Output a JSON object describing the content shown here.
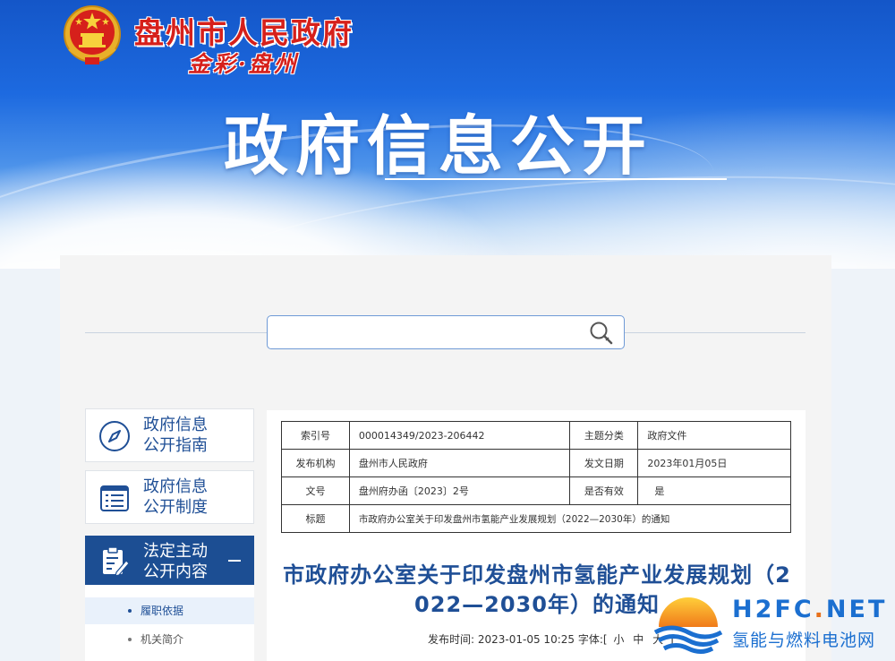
{
  "header": {
    "site_title": "盘州市人民政府",
    "slogan": "金彩·盘州",
    "main_title": "政府信息公开"
  },
  "search": {
    "placeholder": "",
    "value": ""
  },
  "sidebar": {
    "items": [
      {
        "label_line1": "政府信息",
        "label_line2": "公开指南",
        "icon": "compass-icon",
        "active": false
      },
      {
        "label_line1": "政府信息",
        "label_line2": "公开制度",
        "icon": "list-icon",
        "active": false
      },
      {
        "label_line1": "法定主动",
        "label_line2": "公开内容",
        "icon": "clipboard-edit-icon",
        "active": true
      }
    ],
    "sub_items": [
      {
        "label": "履职依据",
        "active": true
      },
      {
        "label": "机关简介",
        "active": false
      }
    ]
  },
  "meta": {
    "index_label": "索引号",
    "index_value": "000014349/2023-206442",
    "category_label": "主题分类",
    "category_value": "政府文件",
    "issuer_label": "发布机构",
    "issuer_value": "盘州市人民政府",
    "date_label": "发文日期",
    "date_value": "2023年01月05日",
    "docno_label": "文号",
    "docno_value": "盘州府办函〔2023〕2号",
    "valid_label": "是否有效",
    "valid_value": "是",
    "title_label": "标题",
    "title_value": "市政府办公室关于印发盘州市氢能产业发展规划（2022—2030年）的通知"
  },
  "article": {
    "title_line1": "市政府办公室关于印发盘州市氢能产业发展规划（2",
    "title_line2": "022—2030年）的通知",
    "publish_prefix": "发布时间:",
    "publish_time": "2023-01-05 10:25",
    "font_label": "字体:[",
    "font_small": "小",
    "font_medium": "中",
    "font_large": "大",
    "font_close": "]"
  },
  "watermark": {
    "brand_a": "H2FC",
    "brand_dot": ".",
    "brand_b": "NET",
    "subtitle": "氢能与燃料电池网"
  },
  "colors": {
    "header_blue": "#1456c8",
    "title_red": "#d6201b",
    "nav_blue": "#1c4e93",
    "link_blue": "#1f4f96",
    "watermark_blue": "#1b6fd0",
    "watermark_orange": "#e8711b"
  }
}
